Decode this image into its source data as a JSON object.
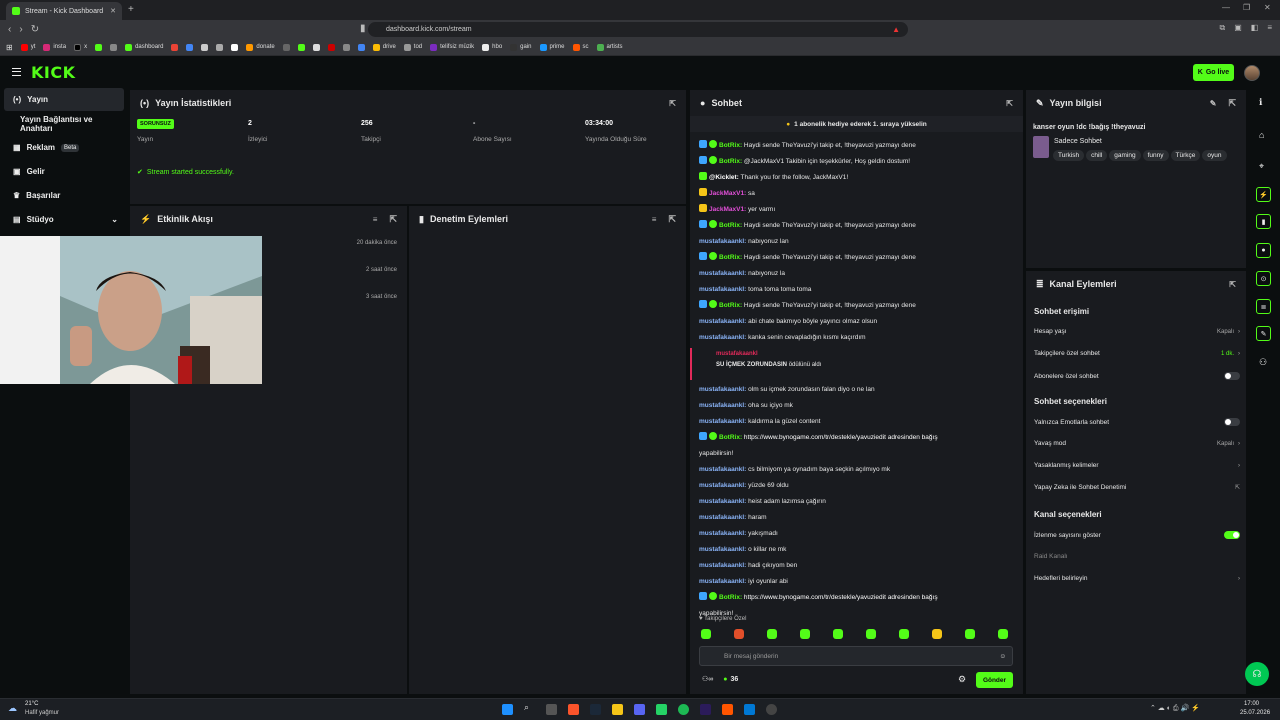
{
  "browser": {
    "tab_title": "Stream - Kick Dashboard",
    "url": "dashboard.kick.com/stream",
    "bookmarks": [
      "yt",
      "insta",
      "x",
      "dashboard",
      "donate",
      "drive",
      "tod",
      "telifsiz müzik",
      "hbo",
      "gain",
      "prime",
      "sc",
      "artists"
    ]
  },
  "kick": {
    "logo": "KICK",
    "go_live": "Go live"
  },
  "sidebar": {
    "items": [
      {
        "label": "Yayın"
      },
      {
        "label": "Yayın Bağlantısı ve Anahtarı"
      },
      {
        "label": "Reklam",
        "badge": "Beta"
      },
      {
        "label": "Gelir"
      },
      {
        "label": "Başarılar"
      },
      {
        "label": "Stüdyo"
      }
    ]
  },
  "stats": {
    "title": "Yayın İstatistikleri",
    "status_badge": "SORUNSUZ",
    "status_label": "Yayın",
    "viewers_value": "2",
    "viewers_label": "İzleyici",
    "followers_value": "256",
    "followers_label": "Takipçi",
    "subs_value": "-",
    "subs_label": "Abone Sayısı",
    "duration_value": "03:34:00",
    "duration_label": "Yayında Olduğu Süre",
    "success_msg": "Stream started successfully."
  },
  "activity": {
    "title": "Etkinlik Akışı",
    "times": [
      "20 dakika önce",
      "2 saat önce",
      "3 saat önce"
    ]
  },
  "moderation": {
    "title": "Denetim Eylemleri"
  },
  "chat": {
    "title": "Sohbet",
    "notice": "1 abonelik hediye ederek 1. sıraya yükselin",
    "messages": [
      {
        "user": "BotRix:",
        "text": " Haydi sende TheYavuzi'yi takip et, !theyavuzi yazmayı dene",
        "color": "#53fc18",
        "icon": "bot"
      },
      {
        "user": "BotRix:",
        "text": " @JackMaxV1 Takibin için teşekkürler, Hoş geldin dostum!",
        "color": "#53fc18",
        "icon": "bot"
      },
      {
        "user": "@Kicklet:",
        "text": " Thank you for the follow, JackMaxV1!",
        "color": "#ffffff",
        "icon": "kl"
      },
      {
        "user": "JackMaxV1:",
        "text": " sa",
        "color": "#e24fd8",
        "icon": "sub"
      },
      {
        "user": "JackMaxV1:",
        "text": " yer varmı",
        "color": "#e24fd8",
        "icon": "sub"
      },
      {
        "user": "BotRix:",
        "text": " Haydi sende TheYavuzi'yi takip et, !theyavuzi yazmayı dene",
        "color": "#53fc18",
        "icon": "bot"
      },
      {
        "user": "mustafakaankl:",
        "text": " nabıyonuz lan",
        "color": "#8ab4f8",
        "icon": ""
      },
      {
        "user": "BotRix:",
        "text": " Haydi sende TheYavuzi'yi takip et, !theyavuzi yazmayı dene",
        "color": "#53fc18",
        "icon": "bot"
      },
      {
        "user": "mustafakaankl:",
        "text": " nabıyonuz la",
        "color": "#8ab4f8",
        "icon": ""
      },
      {
        "user": "mustafakaankl:",
        "text": " toma toma toma toma",
        "color": "#8ab4f8",
        "icon": ""
      },
      {
        "user": "BotRix:",
        "text": " Haydi sende TheYavuzi'yi takip et, !theyavuzi yazmayı dene",
        "color": "#53fc18",
        "icon": "bot"
      },
      {
        "user": "mustafakaankl:",
        "text": " abi chate bakmıyo böyle yayıncı olmaz olsun",
        "color": "#8ab4f8",
        "icon": ""
      },
      {
        "user": "mustafakaankl:",
        "text": " kanka senin cevapladığın kısmı kaçırdım",
        "color": "#8ab4f8",
        "icon": ""
      }
    ],
    "gift_user": "mustafakaankl",
    "gift_text": "SU İÇMEK ZORUNDASIN",
    "gift_suffix": "ödülünü aldı",
    "messages2": [
      {
        "user": "mustafakaankl:",
        "text": " olm su içmek zorundasın falan diyo o ne lan",
        "color": "#8ab4f8",
        "icon": ""
      },
      {
        "user": "mustafakaankl:",
        "text": " oha su içiyo mk",
        "color": "#8ab4f8",
        "icon": ""
      },
      {
        "user": "mustafakaankl:",
        "text": " kaldırma la güzel content",
        "color": "#8ab4f8",
        "icon": ""
      },
      {
        "user": "BotRix:",
        "text": " https://www.bynogame.com/tr/destekle/yavuziedit adresinden bağış",
        "color": "#53fc18",
        "icon": "bot"
      },
      {
        "user": "",
        "text": "yapabilirsin!",
        "color": "#ffffff",
        "icon": ""
      },
      {
        "user": "mustafakaankl:",
        "text": " cs bilmiyom ya oynadım baya seçkin açılmıyo mk",
        "color": "#8ab4f8",
        "icon": ""
      },
      {
        "user": "mustafakaankl:",
        "text": " yüzde 69 oldu",
        "color": "#8ab4f8",
        "icon": ""
      },
      {
        "user": "mustafakaankl:",
        "text": " heist adam lazımsa çağırın",
        "color": "#8ab4f8",
        "icon": ""
      },
      {
        "user": "mustafakaankl:",
        "text": " haram",
        "color": "#8ab4f8",
        "icon": ""
      },
      {
        "user": "mustafakaankl:",
        "text": " yakışmadı",
        "color": "#8ab4f8",
        "icon": ""
      },
      {
        "user": "mustafakaankl:",
        "text": " o killar ne mk",
        "color": "#8ab4f8",
        "icon": ""
      },
      {
        "user": "mustafakaankl:",
        "text": " hadi çıkıyom ben",
        "color": "#8ab4f8",
        "icon": ""
      },
      {
        "user": "mustafakaankl:",
        "text": " iyi oyunlar abi",
        "color": "#8ab4f8",
        "icon": ""
      },
      {
        "user": "BotRix:",
        "text": " https://www.bynogame.com/tr/destekle/yavuziedit adresinden bağış",
        "color": "#53fc18",
        "icon": "bot"
      },
      {
        "user": "",
        "text": "yapabilirsin!",
        "color": "#ffffff",
        "icon": ""
      }
    ],
    "followers_only": "Takipçilere Özel",
    "input_placeholder": "Bir mesaj gönderin",
    "viewer_count": "36",
    "send_label": "Gönder"
  },
  "stream_info": {
    "title": "Yayın bilgisi",
    "stream_title": "kanser oyun !dc !bağış !theyavuzi",
    "category": "Sadece Sohbet",
    "tags": [
      "Turkish",
      "chill",
      "gaming",
      "funny",
      "Türkçe",
      "oyun"
    ]
  },
  "channel_actions": {
    "title": "Kanal Eylemleri",
    "chat_access": "Sohbet erişimi",
    "account_age": "Hesap yaşı",
    "account_age_val": "Kapalı",
    "followers_only": "Takipçilere özel sohbet",
    "followers_only_val": "1 dk.",
    "subs_only": "Abonelere özel sohbet",
    "chat_options": "Sohbet seçenekleri",
    "emotes_only": "Yalnızca Emotlarla sohbet",
    "slow_mode": "Yavaş mod",
    "slow_mode_val": "Kapalı",
    "banned_words": "Yasaklanmış kelimeler",
    "ai_mod": "Yapay Zeka ile Sohbet Denetimi",
    "channel_options": "Kanal seçenekleri",
    "show_viewers": "İzlenme sayısını göster",
    "raid": "Raid Kanalı",
    "goals": "Hedefleri belirleyin"
  },
  "taskbar": {
    "weather_temp": "21°C",
    "weather_desc": "Hafif yağmur",
    "time": "17:00",
    "date": "25.07.2026"
  },
  "colors": {
    "accent": "#53fc18",
    "panel": "#191b1f",
    "bg": "#0b0e0f"
  }
}
